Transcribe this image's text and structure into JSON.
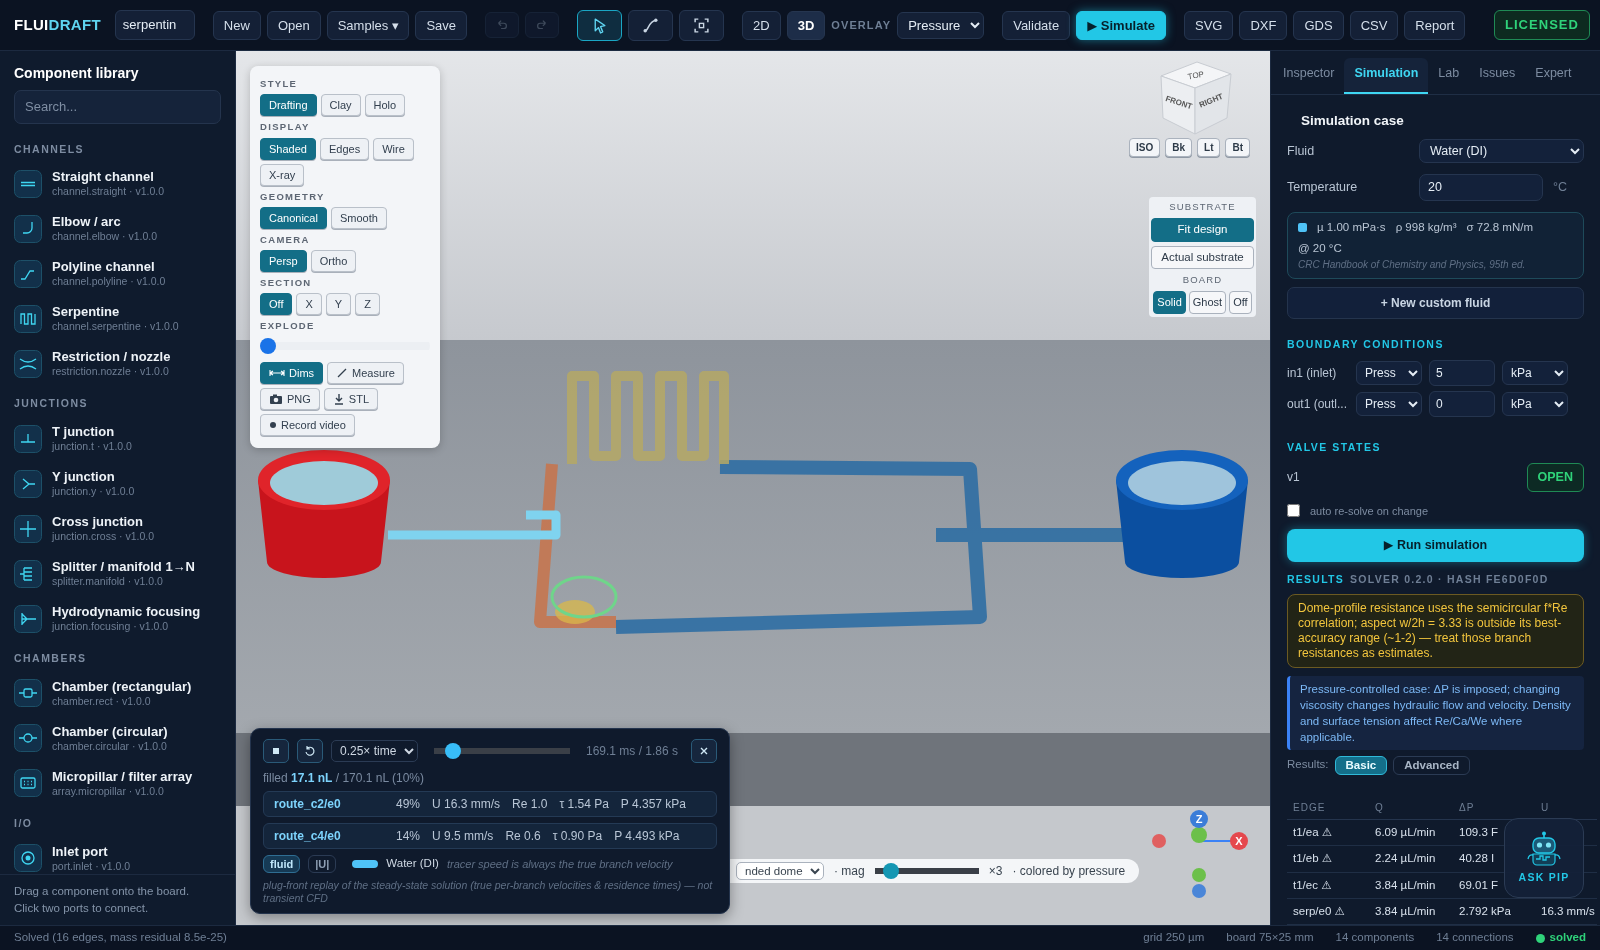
{
  "topbar": {
    "logo": {
      "main": "FLUI",
      "accent": "DRAFT"
    },
    "project_name": "serpentin",
    "file_buttons": [
      "New",
      "Open",
      "Samples ▾",
      "Save"
    ],
    "history_buttons": [
      {
        "disabled": true
      },
      {
        "disabled": true
      }
    ],
    "tools": [
      {
        "selected": true
      },
      {
        "selected": false
      },
      {
        "selected": false
      }
    ],
    "view_modes": [
      {
        "label": "2D",
        "selected": false
      },
      {
        "label": "3D",
        "selected": true
      }
    ],
    "overlay": {
      "label": "OVERLAY",
      "value": "Pressure"
    },
    "actions": [
      {
        "label": "Validate",
        "kind": "secondary"
      },
      {
        "label": "▶ Simulate",
        "kind": "primary"
      }
    ],
    "exports": [
      "SVG",
      "DXF",
      "GDS",
      "CSV",
      "Report"
    ],
    "license": "LICENSED"
  },
  "sidebar": {
    "title": "Component library",
    "search": {
      "placeholder": "Search..."
    },
    "sections": [
      {
        "title": "CHANNELS",
        "items": [
          {
            "label": "Straight channel",
            "id": "channel.straight · v1.0.0"
          },
          {
            "label": "Elbow / arc",
            "id": "channel.elbow · v1.0.0"
          },
          {
            "label": "Polyline channel",
            "id": "channel.polyline · v1.0.0"
          },
          {
            "label": "Serpentine",
            "id": "channel.serpentine · v1.0.0"
          },
          {
            "label": "Restriction / nozzle",
            "id": "restriction.nozzle · v1.0.0"
          }
        ]
      },
      {
        "title": "JUNCTIONS",
        "items": [
          {
            "label": "T junction",
            "id": "junction.t · v1.0.0"
          },
          {
            "label": "Y junction",
            "id": "junction.y · v1.0.0"
          },
          {
            "label": "Cross junction",
            "id": "junction.cross · v1.0.0"
          },
          {
            "label": "Splitter / manifold 1→N",
            "id": "splitter.manifold · v1.0.0"
          },
          {
            "label": "Hydrodynamic focusing",
            "id": "junction.focusing · v1.0.0"
          }
        ]
      },
      {
        "title": "CHAMBERS",
        "items": [
          {
            "label": "Chamber (rectangular)",
            "id": "chamber.rect · v1.0.0"
          },
          {
            "label": "Chamber (circular)",
            "id": "chamber.circular · v1.0.0"
          },
          {
            "label": "Micropillar / filter array",
            "id": "array.micropillar · v1.0.0"
          }
        ]
      },
      {
        "title": "I/O",
        "items": [
          {
            "label": "Inlet port",
            "id": "port.inlet · v1.0.0"
          }
        ]
      }
    ],
    "hint": [
      "Drag a component onto the board.",
      "Click two ports to connect."
    ]
  },
  "viewport": {
    "view_cube": {
      "top": "TOP",
      "front": "FRONT",
      "right": "RIGHT"
    },
    "view_buttons": [
      "ISO",
      "Bk",
      "Lt",
      "Bt"
    ],
    "display_panel": {
      "sections": [
        {
          "title": "STYLE",
          "options": [
            {
              "label": "Drafting",
              "selected": true
            },
            {
              "label": "Clay",
              "selected": false
            },
            {
              "label": "Holo",
              "selected": false
            }
          ]
        },
        {
          "title": "DISPLAY",
          "options": [
            {
              "label": "Shaded",
              "selected": true
            },
            {
              "label": "Edges",
              "selected": false
            },
            {
              "label": "Wire",
              "selected": false
            },
            {
              "label": "X-ray",
              "selected": false
            }
          ]
        },
        {
          "title": "GEOMETRY",
          "options": [
            {
              "label": "Canonical",
              "selected": true
            },
            {
              "label": "Smooth",
              "selected": false
            }
          ]
        },
        {
          "title": "CAMERA",
          "options": [
            {
              "label": "Persp",
              "selected": true
            },
            {
              "label": "Ortho",
              "selected": false
            }
          ]
        },
        {
          "title": "SECTION",
          "options": [
            {
              "label": "Off",
              "selected": true
            },
            {
              "label": "X",
              "selected": false
            },
            {
              "label": "Y",
              "selected": false
            },
            {
              "label": "Z",
              "selected": false
            }
          ]
        }
      ],
      "explode": {
        "label": "EXPLODE",
        "level": 0
      },
      "tools": [
        {
          "label": "Dims",
          "on": true
        },
        {
          "label": "Measure",
          "on": false
        },
        {
          "label": "PNG",
          "on": false
        },
        {
          "label": "STL",
          "on": false
        },
        {
          "label": "Record video",
          "on": false
        }
      ]
    },
    "substrate": {
      "title": "SUBSTRATE",
      "options": [
        {
          "label": "Fit design",
          "selected": true
        },
        {
          "label": "Actual substrate",
          "selected": false
        }
      ],
      "board_title": "BOARD",
      "board_options": [
        {
          "label": "Solid",
          "selected": true
        },
        {
          "label": "Ghost",
          "selected": false
        },
        {
          "label": "Off",
          "selected": false
        }
      ]
    },
    "playback": {
      "speed": "0.25× time",
      "level": 0.09,
      "time": "169.1 ms / 1.86 s",
      "filled": "filled **17.1 nL** / 170.1 nL (10%)",
      "routes": [
        {
          "name": "route_c2/e0",
          "share": "49%",
          "velocity": "U 16.3 mm/s",
          "reynolds": "Re 1.0",
          "shear": "τ 1.54 Pa",
          "pressure": "P 4.357 kPa"
        },
        {
          "name": "route_c4/e0",
          "share": "14%",
          "velocity": "U 9.5 mm/s",
          "reynolds": "Re 0.6",
          "shear": "τ 0.90 Pa",
          "pressure": "P 4.493 kPa"
        }
      ],
      "modes": [
        {
          "label": "fluid",
          "selected": true
        },
        {
          "label": "|U|",
          "selected": false
        }
      ],
      "fluid": {
        "color": "#4fc3f7",
        "name": "Water (DI)"
      },
      "note": "tracer speed is always the true branch velocity",
      "footer": "plug-front replay of the steady-state solution (true per-branch velocities & residence times) — not transient CFD"
    },
    "render_bar": {
      "profile": "nded dome",
      "mag_label": "· mag",
      "level": 0.1,
      "mag_value": "×3",
      "caption": "· colored by pressure"
    },
    "axes": {
      "z": "Z",
      "x": "X"
    }
  },
  "right_panel": {
    "tabs": [
      {
        "label": "Inspector",
        "selected": false
      },
      {
        "label": "Simulation",
        "selected": true
      },
      {
        "label": "Lab",
        "selected": false
      },
      {
        "label": "Issues",
        "selected": false
      },
      {
        "label": "Expert",
        "selected": false
      }
    ],
    "case_title": "Simulation case",
    "fluid": {
      "label": "Fluid",
      "value": "Water (DI)"
    },
    "temperature": {
      "label": "Temperature",
      "value": "20",
      "unit": "°C"
    },
    "fluid_card": {
      "color": "#4fc3f7",
      "props": [
        "µ 1.00 mPa·s",
        "ρ 998 kg/m³",
        "σ 72.8 mN/m"
      ],
      "condition": "@ 20 °C",
      "source": "CRC Handbook of Chemistry and Physics, 95th ed."
    },
    "new_fluid": "+ New custom fluid",
    "boundary_title": "BOUNDARY CONDITIONS",
    "boundaries": [
      {
        "port": "in1 (inlet)",
        "type": "Press",
        "value": "5",
        "unit": "kPa"
      },
      {
        "port": "out1 (outl...",
        "type": "Press",
        "value": "0",
        "unit": "kPa"
      }
    ],
    "valve_title": "VALVE STATES",
    "valves": [
      {
        "label": "v1",
        "state": "OPEN",
        "on": true
      }
    ],
    "auto_resolve": {
      "label": "auto re-solve on change",
      "checked": false
    },
    "run_button": "▶ Run simulation",
    "results": {
      "title": "RESULTS",
      "solver": "SOLVER 0.2.0 · HASH FE6D0F0D",
      "warning": "Dome-profile resistance uses the semicircular f*Re correlation; aspect w/2h = 3.33 is outside its best-accuracy range (~1-2) — treat those branch resistances as estimates.",
      "info": "Pressure-controlled case: ΔP is imposed; changing viscosity changes hydraulic flow and velocity. Density and surface tension affect Re/Ca/We where applicable.",
      "view_label": "Results:",
      "views": [
        {
          "label": "Basic",
          "selected": true
        },
        {
          "label": "Advanced",
          "selected": false
        }
      ],
      "table": {
        "columns": [
          "EDGE",
          "Q",
          "ΔP",
          "U"
        ],
        "rows": [
          [
            "t1/ea ⚠",
            "6.09 µL/min",
            "109.3 F"
          ],
          [
            "t1/eb ⚠",
            "2.24 µL/min",
            "40.28 I"
          ],
          [
            "t1/ec ⚠",
            "3.84 µL/min",
            "69.01 F"
          ],
          [
            "serp/e0 ⚠",
            "3.84 µL/min",
            "2.792 kPa",
            "16.3 mm/s"
          ]
        ]
      }
    },
    "assistant": "ASK PIP"
  },
  "status_bar": {
    "message": "Solved (16 edges, mass residual 8.5e-25)",
    "items": [
      "grid 250 µm",
      "board 75×25 mm",
      "14 components",
      "14 connections"
    ],
    "state": {
      "label": "solved",
      "ok": true
    }
  }
}
